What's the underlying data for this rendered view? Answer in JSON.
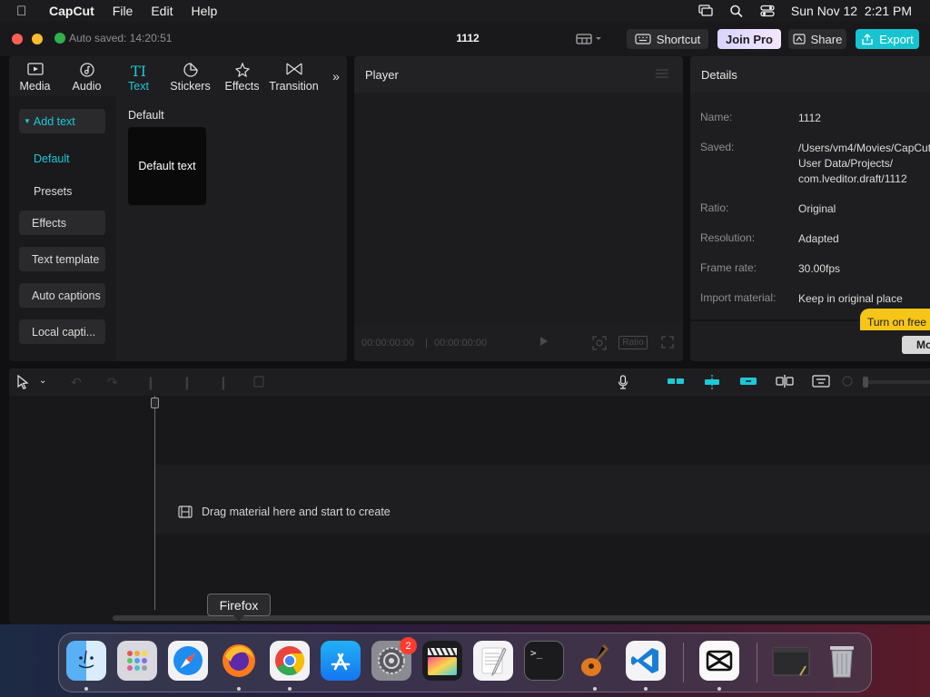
{
  "menubar": {
    "app_name": "CapCut",
    "items": [
      "File",
      "Edit",
      "Help"
    ],
    "datetime": "Sun Nov 12  2:21 PM"
  },
  "titlebar": {
    "autosave": "Auto saved: 14:20:51",
    "project": "1112",
    "shortcut_label": "Shortcut",
    "joinpro_label": "Join Pro",
    "share_label": "Share",
    "export_label": "Export"
  },
  "library": {
    "tabs": [
      {
        "label": "Media",
        "icon": "media-icon"
      },
      {
        "label": "Audio",
        "icon": "audio-icon"
      },
      {
        "label": "Text",
        "icon": "text-icon",
        "active": true
      },
      {
        "label": "Stickers",
        "icon": "stickers-icon"
      },
      {
        "label": "Effects",
        "icon": "effects-icon"
      },
      {
        "label": "Transition",
        "icon": "transition-icon"
      }
    ],
    "sidenav": {
      "add_text": "Add text",
      "default": "Default",
      "presets": "Presets",
      "effects": "Effects",
      "text_template": "Text template",
      "auto_captions": "Auto captions",
      "local_captions": "Local capti..."
    },
    "section_title": "Default",
    "card_label": "Default text"
  },
  "player": {
    "title": "Player",
    "time_current": "00:00:00:00",
    "time_total": "00:00:00:00",
    "ratio_label": "Ratio"
  },
  "details": {
    "title": "Details",
    "rows": [
      {
        "key": "Name:",
        "value": "1112"
      },
      {
        "key": "Saved:",
        "value": "/Users/vm4/Movies/CapCut\nUser Data/Projects/\ncom.lveditor.draft/1112"
      },
      {
        "key": "Ratio:",
        "value": "Original"
      },
      {
        "key": "Resolution:",
        "value": "Adapted"
      },
      {
        "key": "Frame rate:",
        "value": "30.00fps"
      },
      {
        "key": "Import material:",
        "value": "Keep in original place"
      }
    ],
    "turn_on": "Turn on free",
    "modify": "Mo"
  },
  "timeline": {
    "drag_hint": "Drag material here and start to create"
  },
  "tooltip": "Firefox",
  "dock": {
    "settings_badge": "2"
  },
  "colors": {
    "accent": "#1ec8d6",
    "export": "#17c3cf",
    "joinpro": "#e6e0ff",
    "turn_on": "#f5c518"
  }
}
